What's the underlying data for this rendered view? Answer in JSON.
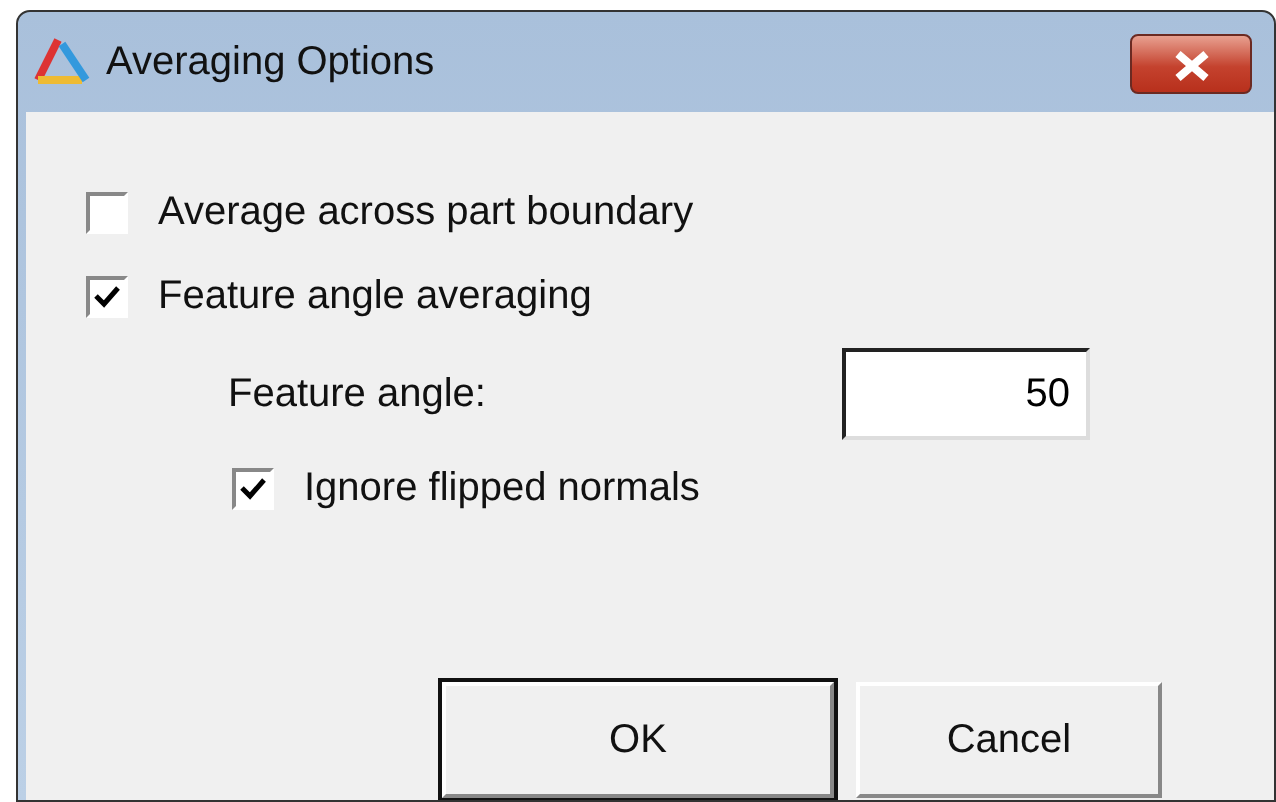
{
  "window": {
    "title": "Averaging Options"
  },
  "options": [
    {
      "label": "Average across part boundary",
      "checked": false
    },
    {
      "label": "Feature angle averaging",
      "checked": true
    }
  ],
  "feature_angle": {
    "label": "Feature angle:",
    "value": "50"
  },
  "sub_option": {
    "label": "Ignore flipped normals",
    "checked": true
  },
  "buttons": [
    {
      "label": "OK",
      "default": true
    },
    {
      "label": "Cancel",
      "default": false
    }
  ]
}
